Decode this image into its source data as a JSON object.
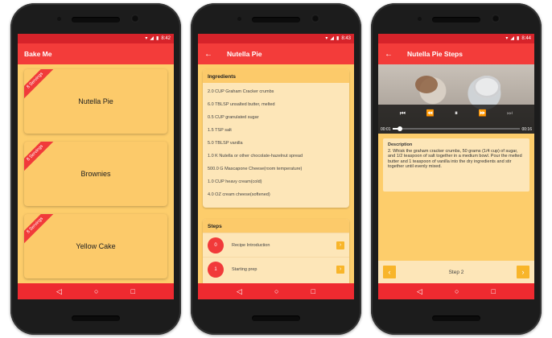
{
  "screens": [
    {
      "status_time": "8:42",
      "appbar_title": "Bake Me",
      "recipes": [
        {
          "name": "Nutella Pie",
          "servings": "8 Servings"
        },
        {
          "name": "Brownies",
          "servings": "8 Servings"
        },
        {
          "name": "Yellow Cake",
          "servings": "8 Servings"
        }
      ]
    },
    {
      "status_time": "8:43",
      "appbar_title": "Nutella Pie",
      "ingredients_title": "Ingredients",
      "ingredients": [
        "2.0 CUP Graham Cracker crumbs",
        "6.0 TBLSP unsalted butter, melted",
        "0.5 CUP granulated sugar",
        "1.5 TSP salt",
        "5.0 TBLSP vanilla",
        "1.0 K Nutella or other chocolate-hazelnut spread",
        "500.0 G Mascapone Cheese(room temperature)",
        "1.0 CUP heavy cream(cold)",
        "4.0 OZ cream cheese(softened)"
      ],
      "steps_title": "Steps",
      "steps": [
        {
          "num": "0",
          "label": "Recipe Introduction"
        },
        {
          "num": "1",
          "label": "Starting prep"
        }
      ]
    },
    {
      "status_time": "8:44",
      "appbar_title": "Nutella Pie Steps",
      "video": {
        "current": "00:01",
        "duration": "00:16",
        "progress": 0.06
      },
      "description_title": "Description",
      "description_text": "2. Whisk the graham cracker crumbs, 50 grams (1/4 cup) of sugar, and 1/2 teaspoon of salt together in a medium bowl. Pour the melted butter and 1 teaspoon of vanilla into the dry ingredients and stir together until evenly mixed.",
      "step_label": "Step 2"
    }
  ],
  "icons": {
    "back": "arrow-back-icon",
    "nav_back": "triangle-back-icon",
    "nav_home": "circle-home-icon",
    "nav_recent": "square-recent-icon",
    "wifi": "wifi-icon",
    "signal": "signal-icon",
    "battery": "battery-icon",
    "skip_prev": "skip-previous-icon",
    "rewind": "rewind-icon",
    "pause": "pause-icon",
    "fast_forward": "fast-forward-icon",
    "skip_next": "skip-next-icon",
    "chevron_left": "chevron-left-icon",
    "chevron_right": "chevron-right-icon"
  },
  "colors": {
    "primary": "#f33c3a",
    "status": "#d6232a",
    "background": "#fdcd6b",
    "card": "#fcca6a",
    "accent": "#f8b52a"
  }
}
